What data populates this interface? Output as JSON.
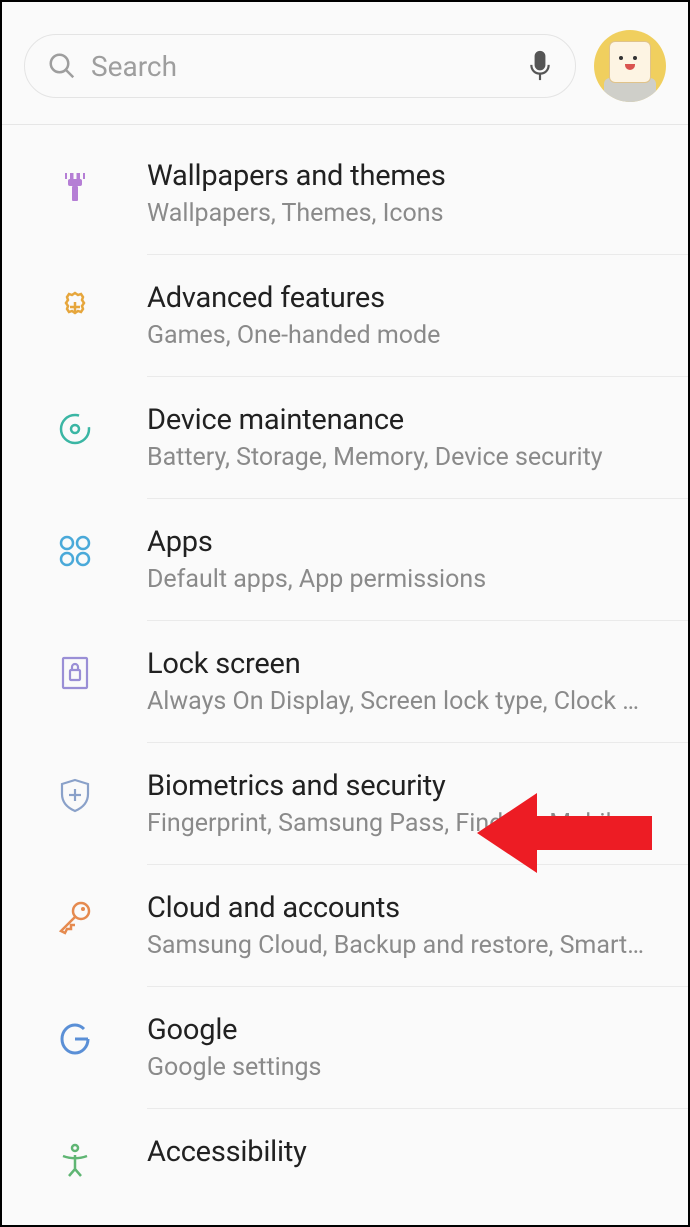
{
  "search": {
    "placeholder": "Search"
  },
  "items": [
    {
      "title": "Wallpapers and themes",
      "subtitle": "Wallpapers, Themes, Icons"
    },
    {
      "title": "Advanced features",
      "subtitle": "Games, One-handed mode"
    },
    {
      "title": "Device maintenance",
      "subtitle": "Battery, Storage, Memory, Device security"
    },
    {
      "title": "Apps",
      "subtitle": "Default apps, App permissions"
    },
    {
      "title": "Lock screen",
      "subtitle": "Always On Display, Screen lock type, Clock style"
    },
    {
      "title": "Biometrics and security",
      "subtitle": "Fingerprint, Samsung Pass, Find My Mobile, Secure Folder"
    },
    {
      "title": "Cloud and accounts",
      "subtitle": "Samsung Cloud, Backup and restore, Smart Switch"
    },
    {
      "title": "Google",
      "subtitle": "Google settings"
    },
    {
      "title": "Accessibility",
      "subtitle": ""
    }
  ],
  "annotation": {
    "arrow_target": "Biometrics and security"
  }
}
